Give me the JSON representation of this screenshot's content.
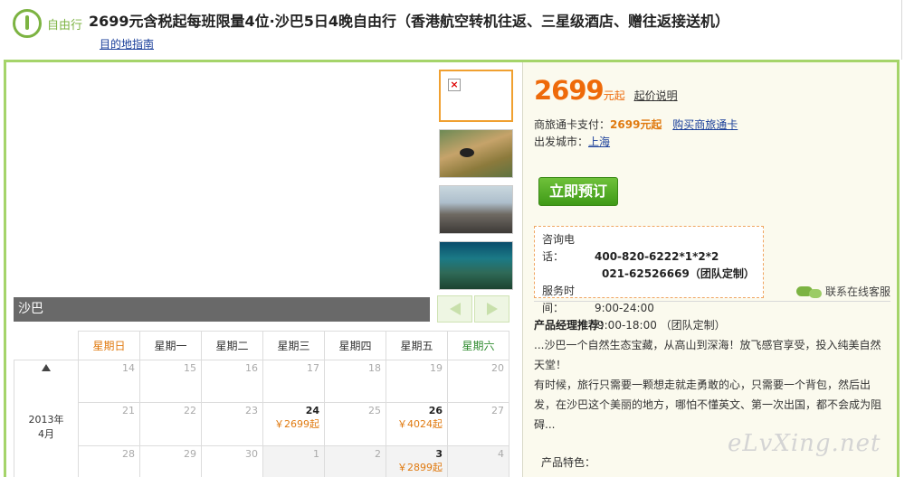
{
  "header": {
    "tag": "自由行",
    "title": "2699元含税起每班限量4位·沙巴5日4晚自由行（香港航空转机往返、三星级酒店、赠往返接送机）",
    "guide_link": "目的地指南"
  },
  "gallery": {
    "caption": "沙巴",
    "thumbnails": [
      "broken-image",
      "clownfish-anemone",
      "mountain-rocks",
      "underwater-reef"
    ]
  },
  "calendar": {
    "weekdays": [
      "星期日",
      "星期一",
      "星期二",
      "星期三",
      "星期四",
      "星期五",
      "星期六"
    ],
    "year": "2013年",
    "month": "4月",
    "rows": [
      [
        {
          "d": "14"
        },
        {
          "d": "15"
        },
        {
          "d": "16"
        },
        {
          "d": "17"
        },
        {
          "d": "18"
        },
        {
          "d": "19"
        },
        {
          "d": "20"
        }
      ],
      [
        {
          "d": "21"
        },
        {
          "d": "22"
        },
        {
          "d": "23"
        },
        {
          "d": "24",
          "p": "￥2699起"
        },
        {
          "d": "25"
        },
        {
          "d": "26",
          "p": "￥4024起"
        },
        {
          "d": "27"
        }
      ],
      [
        {
          "d": "28"
        },
        {
          "d": "29"
        },
        {
          "d": "30"
        },
        {
          "d": "1"
        },
        {
          "d": "2"
        },
        {
          "d": "3",
          "p": "￥2899起"
        },
        {
          "d": "4"
        }
      ]
    ]
  },
  "price": {
    "amount": "2699",
    "unit": "元起",
    "explain_link": "起价说明"
  },
  "card_pay": {
    "label": "商旅通卡支付：",
    "value": "2699元起",
    "buy_link": "购买商旅通卡"
  },
  "departure": {
    "label": "出发城市：",
    "city": "上海"
  },
  "book_button": "立即预订",
  "contact": {
    "phone_label": "咨询电话：",
    "phone1": "400-820-6222*1*2*2",
    "phone2": "021-62526669（团队定制）",
    "hours_label": "服务时间：",
    "hours1": "9:00-24:00",
    "hours2": "9:00-18:00 （团队定制）"
  },
  "online_service": "联系在线客服",
  "recommend": {
    "heading": "产品经理推荐：",
    "line1": "...沙巴一个自然生态宝藏，从高山到深海！放飞感官享受，投入纯美自然天堂！",
    "line2": "有时候，旅行只需要一颗想走就走勇敢的心，只需要一个背包，然后出发，在沙巴这个美丽的地方，哪怕不懂英文、第一次出国，都不会成为阻碍..."
  },
  "features_heading": "产品特色：",
  "watermark": "eLvXing.net",
  "colors": {
    "brand_green": "#7cb342",
    "price_orange": "#ee6a0a",
    "frame_border": "#a5d46a"
  }
}
